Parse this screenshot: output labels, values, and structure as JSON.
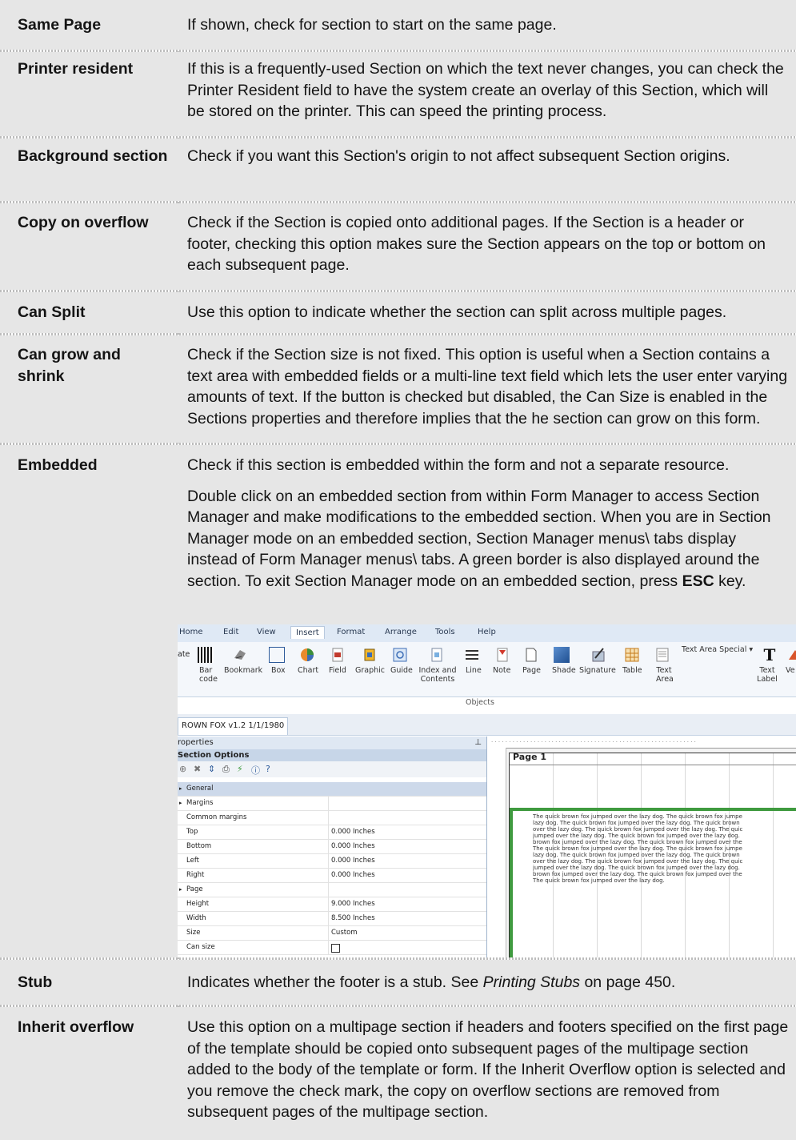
{
  "rows": [
    {
      "term": "Same Page",
      "desc": [
        "If shown, check for section to start on the same page."
      ]
    },
    {
      "term": "Printer resident",
      "desc": [
        "If this is a frequently-used Section on which the text never changes, you can check the Printer Resident field to have the system create an overlay of this Section, which will be stored on the printer. This can speed the printing process."
      ]
    },
    {
      "term": "Background section",
      "desc": [
        "Check if you want this Section's origin to not affect subsequent Section origins."
      ]
    },
    {
      "term": "Copy on overflow",
      "desc": [
        "Check if the Section is copied onto additional pages. If the Section is a header or footer, checking this option makes sure the Section appears on the top or bottom on each subsequent page."
      ]
    },
    {
      "term": "Can Split",
      "desc": [
        "Use this option to indicate whether the section can split across multiple pages."
      ]
    },
    {
      "term": "Can grow and shrink",
      "desc": [
        "Check if the Section size is not fixed. This option is useful when a Section contains a text area with embedded fields or a multi-line text field which lets the user enter varying amounts of text. If the button is checked but disabled, the Can Size is enabled in the Sections properties and therefore implies that the he section can grow on this form."
      ]
    },
    {
      "term": "Embedded",
      "desc": [
        "Check if this section is embedded within the form and not a separate resource."
      ]
    },
    {
      "term": "Stub",
      "desc": []
    },
    {
      "term": "Inherit overflow",
      "desc": [
        "Use this option on a multipage section if headers and footers specified on the first page of the template should be copied onto subsequent pages of the multipage section added to the body of the template or form. If the Inherit Overflow option is selected and you remove the check mark, the copy on overflow sections are removed from subsequent pages of the multipage section."
      ]
    }
  ],
  "embedded_p2": {
    "before": "Double click on an embedded section from within Form Manager to access Section Manager and make modifications to the embedded section. When you are in Section Manager mode on an embedded section, Section Manager menus\\ tabs display instead of Form Manager menus\\ tabs. A green border is also displayed around the section. To exit Section Manager mode on an embedded section, press ",
    "bold": "ESC",
    "after": " key."
  },
  "stub": {
    "before": "Indicates whether the footer is a stub. See ",
    "italic": "Printing Stubs",
    "after": " on page 450."
  },
  "screenshot": {
    "menu": [
      "Home",
      "Edit",
      "View",
      "Insert",
      "Format",
      "Arrange",
      "Tools",
      "Help"
    ],
    "active_menu": "Insert",
    "ribbon_left_stub": "ate",
    "ribbon": [
      {
        "label": "Bar code",
        "icon": "barcode-icon"
      },
      {
        "label": "Bookmark",
        "icon": "bookmark-icon"
      },
      {
        "label": "Box",
        "icon": "box-icon"
      },
      {
        "label": "Chart",
        "icon": "chart-icon"
      },
      {
        "label": "Field",
        "icon": "field-icon"
      },
      {
        "label": "Graphic",
        "icon": "graphic-icon"
      },
      {
        "label": "Guide",
        "icon": "guide-icon"
      },
      {
        "label": "Index and Contents",
        "icon": "index-icon"
      },
      {
        "label": "Line",
        "icon": "line-icon"
      },
      {
        "label": "Note",
        "icon": "note-icon"
      },
      {
        "label": "Page",
        "icon": "page-icon"
      },
      {
        "label": "Shade",
        "icon": "shade-icon"
      },
      {
        "label": "Signature",
        "icon": "signature-icon"
      },
      {
        "label": "Table",
        "icon": "table-icon"
      },
      {
        "label": "Text Area",
        "icon": "text-area-icon"
      },
      {
        "label": "Text Label",
        "icon": "text-label-icon"
      },
      {
        "label": "Ve",
        "icon": "vector-icon"
      }
    ],
    "text_area_special": "Text Area Special ▾",
    "group_label": "Objects",
    "doc_tab": "ROWN FOX v1.2 1/1/1980",
    "properties_title": "roperties",
    "section_options": "Section Options",
    "props": [
      {
        "k": "General",
        "v": "",
        "type": "general"
      },
      {
        "k": "Margins",
        "v": "",
        "type": "group"
      },
      {
        "k": "Common margins",
        "v": ""
      },
      {
        "k": "Top",
        "v": "0.000 Inches"
      },
      {
        "k": "Bottom",
        "v": "0.000 Inches"
      },
      {
        "k": "Left",
        "v": "0.000 Inches"
      },
      {
        "k": "Right",
        "v": "0.000 Inches"
      },
      {
        "k": "Page",
        "v": "",
        "type": "group"
      },
      {
        "k": "Height",
        "v": "9.000 Inches"
      },
      {
        "k": "Width",
        "v": "8.500 Inches"
      },
      {
        "k": "Size",
        "v": "Custom"
      },
      {
        "k": "Can size",
        "v": "",
        "type": "checkbox"
      }
    ],
    "page_label": "Page  1",
    "sample_lines": [
      "The quick brown fox jumped over the lazy dog. The quick brown fox jumpe",
      "lazy dog. The quick brown fox jumped over the lazy dog. The quick brown",
      "over the lazy dog. The quick brown fox jumped over the lazy dog. The quic",
      "jumped over the lazy dog. The quick brown fox jumped over the lazy dog.",
      "brown fox jumped over the lazy dog. The quick brown fox jumped over the",
      "The quick brown fox jumped over the lazy dog. The quick brown fox jumpe",
      "lazy dog. The quick brown fox jumped over the lazy dog. The quick brown",
      "over the lazy dog. The quick brown fox jumped over the lazy dog. The quic",
      "jumped over the lazy dog. The quick brown fox jumped over the lazy dog.",
      "brown fox jumped over the lazy dog. The quick brown fox jumped over the",
      "The quick brown fox jumped over the lazy dog."
    ]
  }
}
